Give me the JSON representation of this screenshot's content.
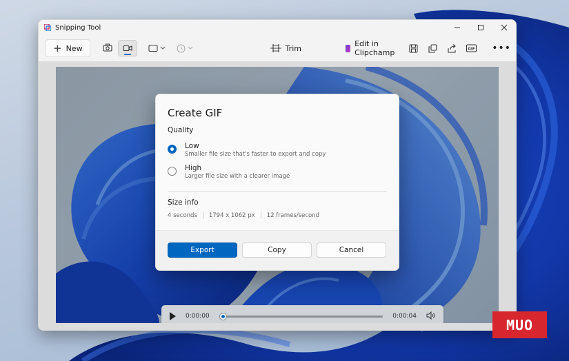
{
  "window": {
    "title": "Snipping Tool"
  },
  "toolbar": {
    "new_label": "New",
    "trim_label": "Trim",
    "clipchamp_label": "Edit in Clipchamp"
  },
  "dialog": {
    "title": "Create GIF",
    "quality_label": "Quality",
    "options": [
      {
        "label": "Low",
        "desc": "Smaller file size that's faster to export and copy",
        "selected": true
      },
      {
        "label": "High",
        "desc": "Larger file size with a clearer image",
        "selected": false
      }
    ],
    "size_info_label": "Size info",
    "duration": "4 seconds",
    "dimensions": "1794 x 1062 px",
    "fps": "12 frames/second",
    "export_label": "Export",
    "copy_label": "Copy",
    "cancel_label": "Cancel"
  },
  "player": {
    "current_time": "0:00:00",
    "total_time": "0:00:04",
    "progress": 0
  },
  "watermark": {
    "text": "MUO"
  },
  "colors": {
    "accent": "#0067c0",
    "logo_bg": "#d8262f"
  }
}
